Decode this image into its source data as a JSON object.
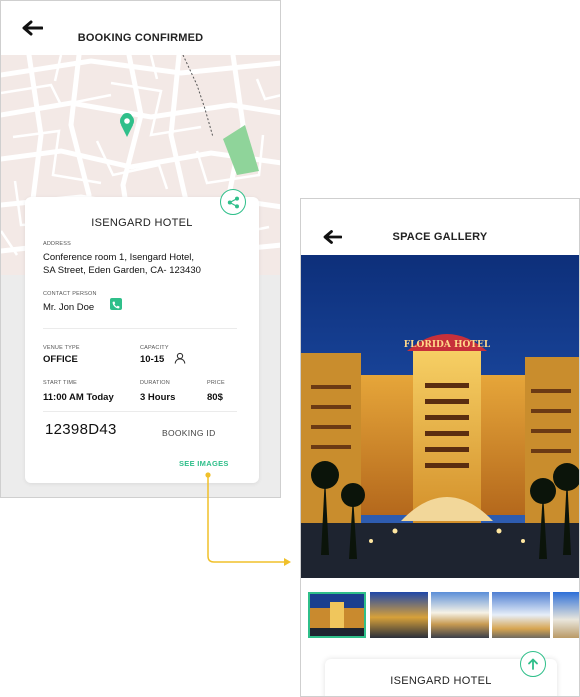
{
  "screen1": {
    "title": "BOOKING CONFIRMED",
    "card": {
      "hotel_name": "ISENGARD HOTEL",
      "address_label": "ADDRESS",
      "address_line1": "Conference room 1, Isengard Hotel,",
      "address_line2": "SA Street, Eden Garden, CA- 123430",
      "contact_label": "CONTACT PERSON",
      "contact_name": "Mr. Jon Doe",
      "venue_type_label": "VENUE TYPE",
      "venue_type": "OFFICE",
      "capacity_label": "CAPACITY",
      "capacity": "10-15",
      "start_time_label": "START TIME",
      "start_time": "11:00 AM Today",
      "duration_label": "DURATION",
      "duration": "3 Hours",
      "price_label": "PRICE",
      "price": "80$",
      "booking_id": "12398D43",
      "booking_id_label": "BOOKING ID",
      "see_images": "SEE IMAGES"
    },
    "icons": {
      "back": "arrow-left-icon",
      "map_pin": "map-pin-icon",
      "share": "share-icon",
      "phone": "phone-icon",
      "capacity": "user-icon"
    }
  },
  "screen2": {
    "title": "SPACE GALLERY",
    "hero_sign": "FLORIDA HOTEL",
    "hotel_name": "ISENGARD HOTEL",
    "icons": {
      "back": "arrow-left-icon",
      "scroll_up": "arrow-up-icon"
    }
  },
  "colors": {
    "accent": "#2fbf8a",
    "connector": "#f0c02a",
    "map_bg": "#f3e9e6",
    "park": "#8fd49a"
  }
}
